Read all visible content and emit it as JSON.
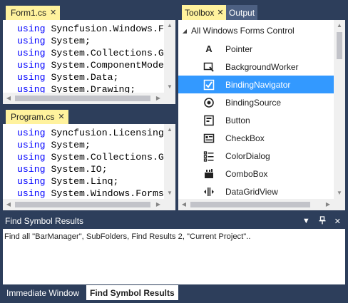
{
  "editor_top": {
    "tab_label": "Form1.cs",
    "lines": [
      {
        "keyword": "using",
        "text": " Syncfusion.Windows.F"
      },
      {
        "keyword": "using",
        "text": " System;"
      },
      {
        "keyword": "using",
        "text": " System.Collections.G"
      },
      {
        "keyword": "using",
        "text": " System.ComponentMode"
      },
      {
        "keyword": "using",
        "text": " System.Data;"
      },
      {
        "keyword": "using",
        "text": " System.Drawing;"
      }
    ]
  },
  "editor_bottom": {
    "tab_label": "Program.cs",
    "lines": [
      {
        "keyword": "using",
        "text": " Syncfusion.Licensing"
      },
      {
        "keyword": "using",
        "text": " System;"
      },
      {
        "keyword": "using",
        "text": " System.Collections.G"
      },
      {
        "keyword": "using",
        "text": " System.IO;"
      },
      {
        "keyword": "using",
        "text": " System.Linq;"
      },
      {
        "keyword": "using",
        "text": " System.Windows.Forms"
      }
    ]
  },
  "toolbox": {
    "tab_active": "Toolbox",
    "tab_inactive": "Output",
    "group_label": "All Windows Forms Control",
    "items": [
      {
        "label": "Pointer",
        "icon": "pointer-icon",
        "selected": false
      },
      {
        "label": "BackgroundWorker",
        "icon": "background-worker-icon",
        "selected": false
      },
      {
        "label": "BindingNavigator",
        "icon": "binding-navigator-icon",
        "selected": true
      },
      {
        "label": "BindingSource",
        "icon": "binding-source-icon",
        "selected": false
      },
      {
        "label": "Button",
        "icon": "button-control-icon",
        "selected": false
      },
      {
        "label": "CheckBox",
        "icon": "checkbox-control-icon",
        "selected": false
      },
      {
        "label": "ColorDialog",
        "icon": "color-dialog-icon",
        "selected": false
      },
      {
        "label": "ComboBox",
        "icon": "combobox-control-icon",
        "selected": false
      },
      {
        "label": "DataGridView",
        "icon": "datagridview-icon",
        "selected": false
      }
    ]
  },
  "find_results": {
    "title": "Find Symbol Results",
    "message": "Find all \"BarManager\", SubFolders, Find Results 2, \"Current Project\".."
  },
  "bottom_tabs": {
    "immediate": "Immediate Window",
    "find": "Find Symbol Results"
  },
  "colors": {
    "frame": "#2d3e5b",
    "active_tab": "#fff29d",
    "selection": "#3399ff",
    "keyword": "#0000ff"
  }
}
